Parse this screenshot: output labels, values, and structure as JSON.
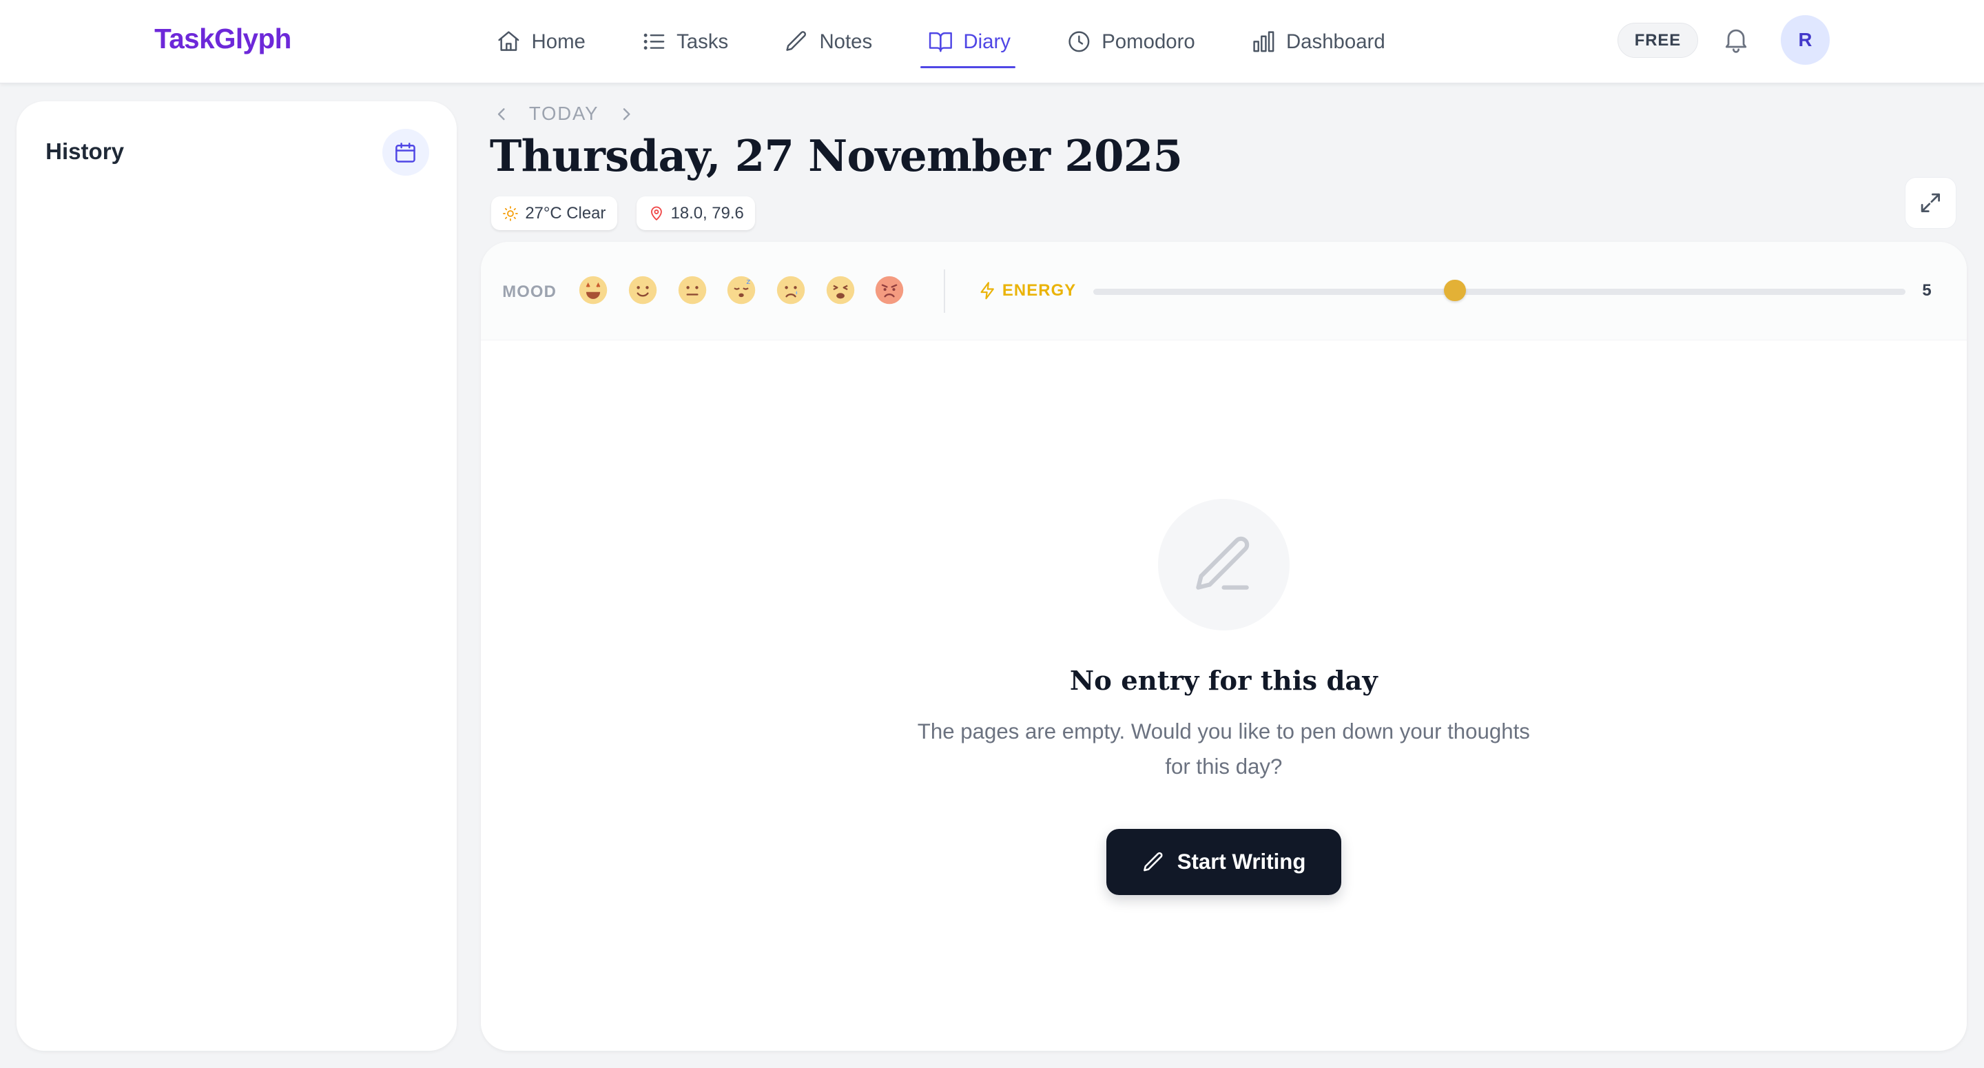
{
  "app": {
    "brand": "TaskGlyph"
  },
  "nav": {
    "items": [
      {
        "label": "Home",
        "icon": "home-icon"
      },
      {
        "label": "Tasks",
        "icon": "list-icon"
      },
      {
        "label": "Notes",
        "icon": "pencil-icon"
      },
      {
        "label": "Diary",
        "icon": "book-open-icon",
        "active": true
      },
      {
        "label": "Pomodoro",
        "icon": "clock-icon"
      },
      {
        "label": "Dashboard",
        "icon": "bar-chart-icon"
      }
    ],
    "plan": "FREE",
    "avatar_initial": "R"
  },
  "sidebar": {
    "title": "History"
  },
  "diary": {
    "date_nav_label": "TODAY",
    "date_title": "Thursday, 27 November 2025",
    "weather": "27°C Clear",
    "location": "18.0, 79.6"
  },
  "mood": {
    "label": "MOOD",
    "options": [
      "🤩",
      "🙂",
      "😐",
      "😴",
      "😢",
      "😫",
      "😡"
    ]
  },
  "energy": {
    "label": "ENERGY",
    "value": "5",
    "level_fraction": 0.445
  },
  "empty_state": {
    "title": "No entry for this day",
    "description": "The pages are empty. Would you like to pen down your thoughts for this day?",
    "cta": "Start Writing"
  },
  "colors": {
    "brand": "#6d28d9",
    "active_nav": "#4f46e5",
    "energy": "#eab308",
    "primary_button": "#111827"
  }
}
